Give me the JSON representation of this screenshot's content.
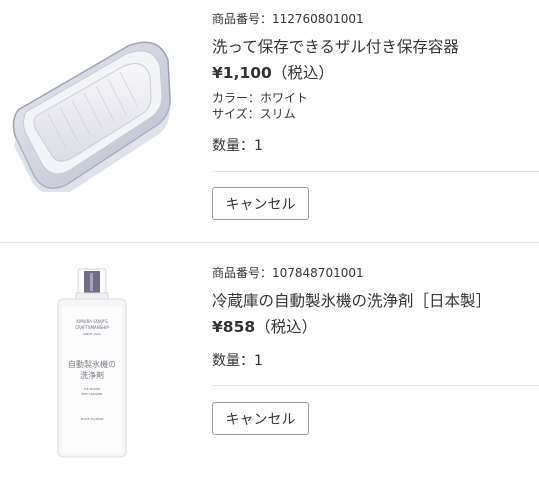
{
  "items": [
    {
      "product_number": "商品番号：112760801001",
      "name": "洗って保存できるザル付き保存容器",
      "price": "¥1,100",
      "tax_note": "（税込）",
      "color": "カラー：ホワイト",
      "size": "サイズ：スリム",
      "quantity": "数量：1",
      "cancel_label": "キャンセル"
    },
    {
      "product_number": "商品番号：107848701001",
      "name": "冷蔵庫の自動製氷機の洗浄剤［日本製］",
      "price": "¥858",
      "tax_note": "（税込）",
      "quantity": "数量：1",
      "cancel_label": "キャンセル",
      "bottle_label": {
        "brand_line1": "KIMURA SOAP'S",
        "brand_line2": "CRAFTSMANSHIP",
        "brand_line3": "SINCE 1924",
        "title_line1": "自動製氷機の",
        "title_line2": "洗浄剤",
        "sub_line1": "ICE MAKER",
        "sub_line2": "PIPE CLEANER",
        "footer": "MADE IN JAPAN"
      }
    }
  ]
}
